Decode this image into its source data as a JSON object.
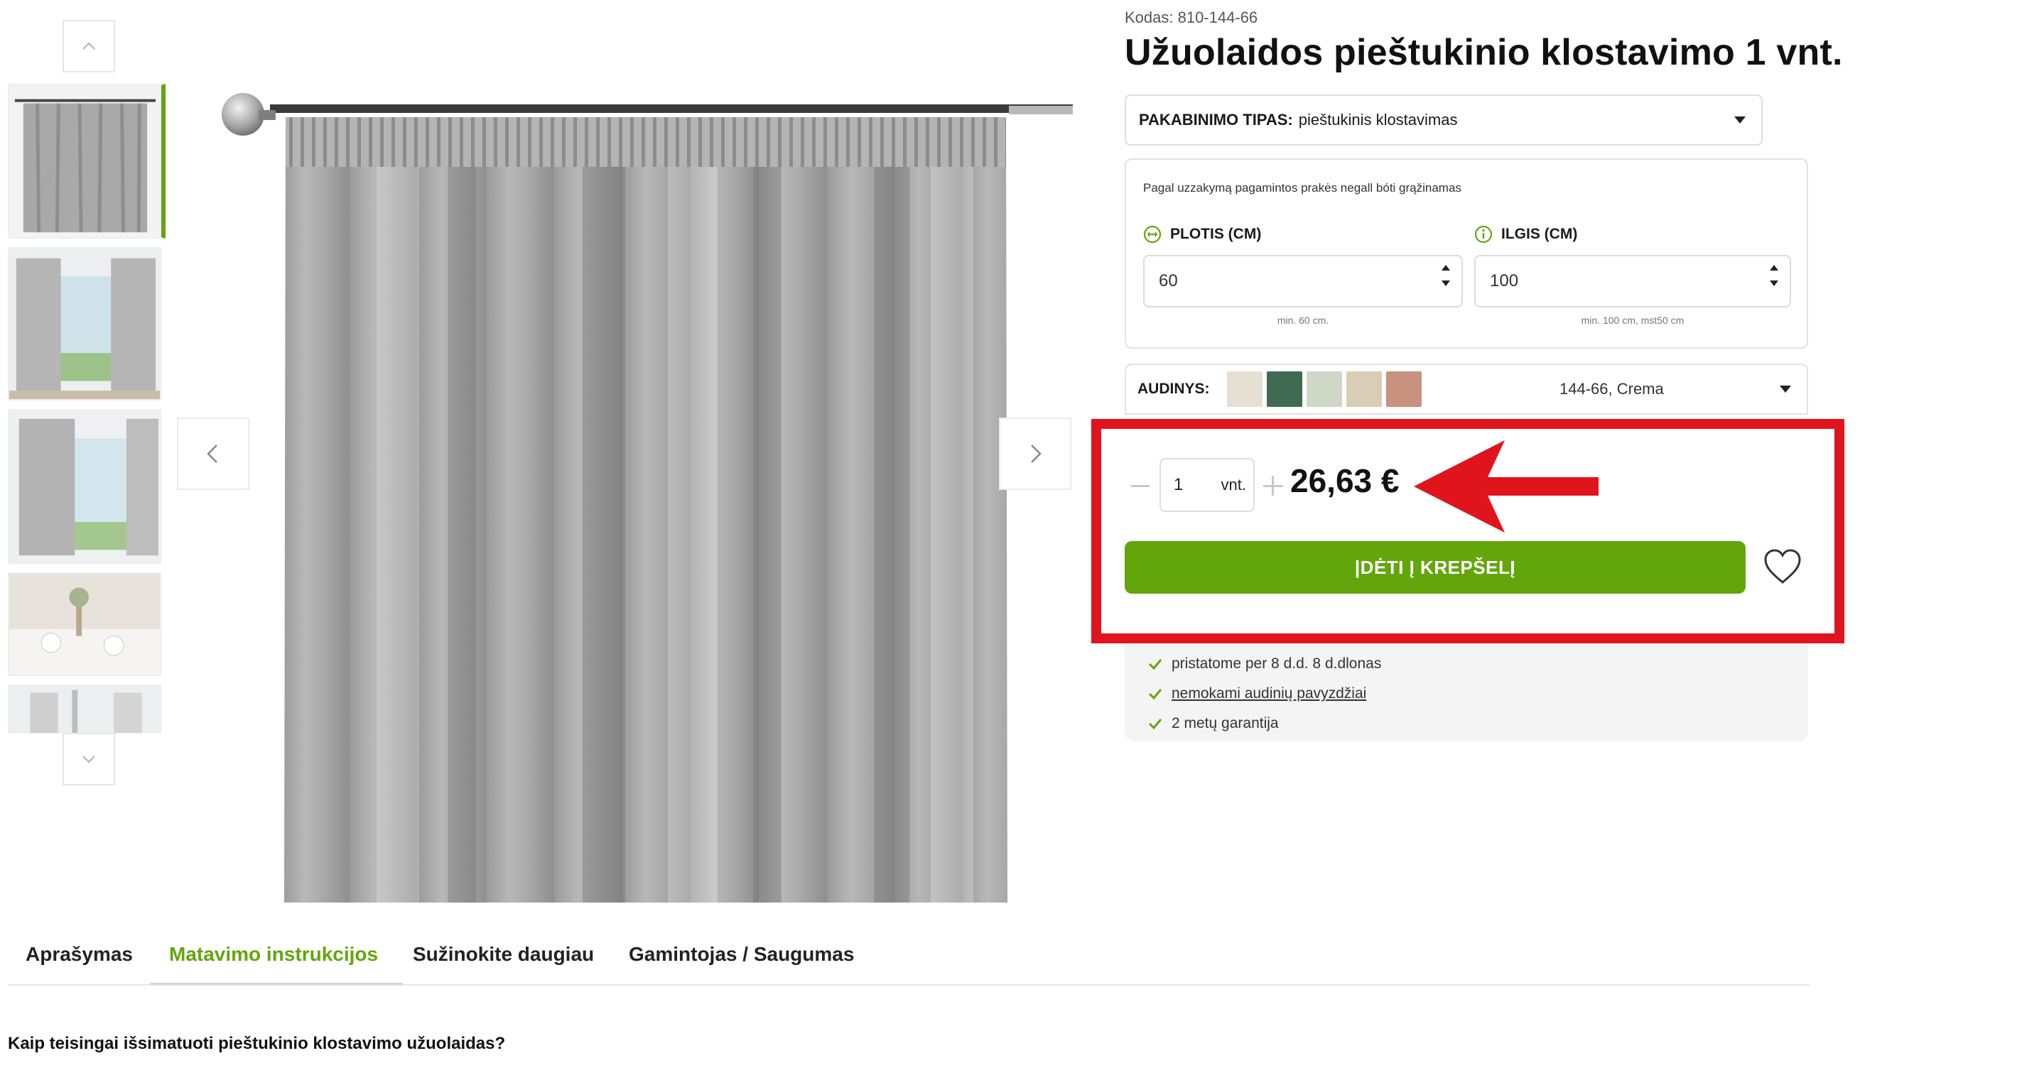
{
  "product": {
    "sku": "Kodas: 810-144-66",
    "title": "Užuolaidos pieštukinio klostavimo 1 vnt."
  },
  "mount_type": {
    "label": "PAKABINIMO TIPAS:",
    "value": "pieštukinis klostavimas"
  },
  "dimensions": {
    "note": "Pagal uzzakymą pagamintos prakės negall bóti grąžinamas",
    "width": {
      "label": "PLOTIS (CM)",
      "value": "60",
      "hint": "min. 60 cm."
    },
    "length": {
      "label": "ILGIS (CM)",
      "value": "100",
      "hint": "min. 100 cm, mst50 cm"
    }
  },
  "fabric": {
    "label": "AUDINYS:",
    "value": "144-66, Crema",
    "swatch_colors": [
      "#e6e0d2",
      "#3f6b55",
      "#cfd8c6",
      "#d9cdb6",
      "#c9927e"
    ]
  },
  "purchase": {
    "quantity": "1",
    "unit": "vnt.",
    "price": "26,63 €",
    "add_to_cart": "|DĖTI Į KREPŠELĮ"
  },
  "benefits": [
    {
      "text": "pristatome per 8 d.d. 8 d.dlonas",
      "link": false
    },
    {
      "text": "nemokami audinių pavyzdžiai",
      "link": true
    },
    {
      "text": "2 metų garantija",
      "link": false
    }
  ],
  "tabs": [
    {
      "label": "Aprašymas",
      "active": false
    },
    {
      "label": "Matavimo instrukcijos",
      "active": true
    },
    {
      "label": "Sužinokite daugiau",
      "active": false
    },
    {
      "label": "Gamintojas / Saugumas",
      "active": false
    }
  ],
  "section": {
    "question": "Kaip teisingai išsimatuoti pieštukinio klostavimo užuolaidas?"
  },
  "colors": {
    "accent_green": "#62a60c",
    "highlight_red": "#e0141c"
  },
  "icons": {
    "thumbs_up": "chevron-up-icon",
    "thumbs_down": "chevron-down-icon",
    "gallery_prev": "chevron-left-icon",
    "gallery_next": "chevron-right-icon",
    "width_info": "width-icon",
    "length_info": "info-icon",
    "wishlist": "heart-icon",
    "benefit": "check-icon"
  }
}
